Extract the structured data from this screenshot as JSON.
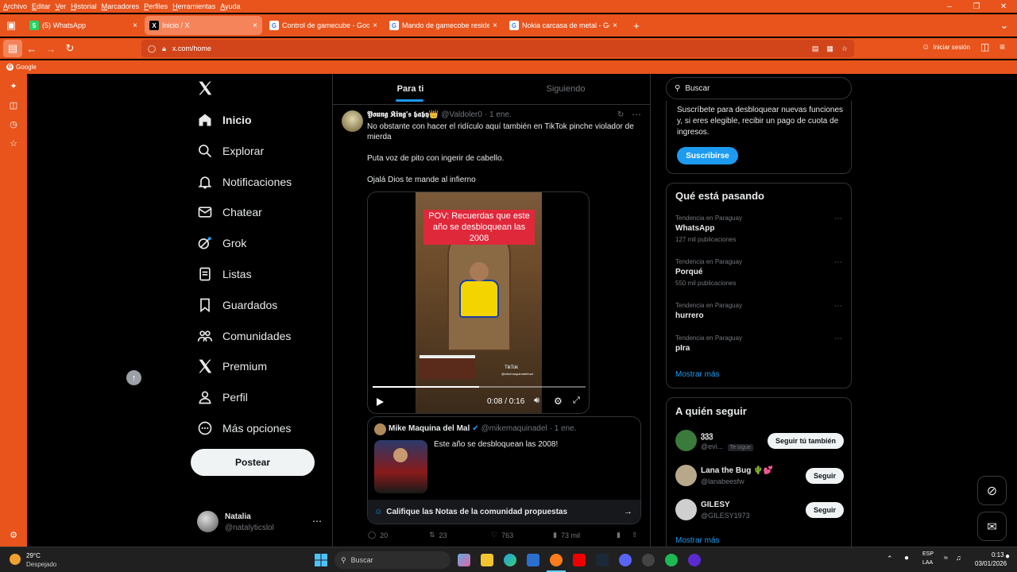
{
  "browser": {
    "menu": [
      "Archivo",
      "Editar",
      "Ver",
      "Historial",
      "Marcadores",
      "Perfiles",
      "Herramientas",
      "Ayuda"
    ],
    "tabs": [
      {
        "title": "(5) WhatsApp",
        "favicon": "whatsapp-icon",
        "color": "#25d366",
        "glyph": "5"
      },
      {
        "title": "Inicio / X",
        "favicon": "x-logo-icon",
        "color": "#000000",
        "glyph": "X"
      },
      {
        "title": "Control de gamecube - Google",
        "favicon": "google-icon",
        "color": "#ffffff",
        "glyph": "G"
      },
      {
        "title": "Mando de gamecobe resident e",
        "favicon": "google-icon",
        "color": "#ffffff",
        "glyph": "G"
      },
      {
        "title": "Nokia carcasa de metal - Googl",
        "favicon": "google-icon",
        "color": "#ffffff",
        "glyph": "G"
      }
    ],
    "url": "x.com/home",
    "signin": "Iniciar sesión",
    "bookmark": "Google",
    "accent": "#e8541c"
  },
  "nav": {
    "items": [
      {
        "label": "Inicio",
        "icon": "home-icon",
        "bold": true
      },
      {
        "label": "Explorar",
        "icon": "search-icon"
      },
      {
        "label": "Notificaciones",
        "icon": "bell-icon"
      },
      {
        "label": "Chatear",
        "icon": "mail-icon"
      },
      {
        "label": "Grok",
        "icon": "grok-icon"
      },
      {
        "label": "Listas",
        "icon": "list-icon"
      },
      {
        "label": "Guardados",
        "icon": "bookmark-icon"
      },
      {
        "label": "Comunidades",
        "icon": "communities-icon"
      },
      {
        "label": "Premium",
        "icon": "x-premium-icon"
      },
      {
        "label": "Perfil",
        "icon": "person-icon"
      },
      {
        "label": "Más opciones",
        "icon": "more-circle-icon"
      }
    ],
    "post_label": "Postear",
    "account": {
      "name": "Natalia",
      "handle": "@natalyticslol"
    }
  },
  "feed": {
    "tabs": [
      "Para ti",
      "Siguiendo"
    ],
    "post": {
      "author": "𝖄𝖔𝖚𝖓𝖌 𝕶𝖎𝖓𝖌'𝖘 𝖇𝖆𝖇𝖞👑",
      "handle": "@Valdoler0",
      "date": "· 1 ene.",
      "lines": [
        "No obstante con hacer el ridículo aquí también en TikTok pinche violador de mierda",
        "Puta voz de pito con ingerir de cabello.",
        "Ojalá Dios te mande al infierno"
      ],
      "video": {
        "caption": "POV: Recuerdas que este año se desbloquean las 2008",
        "time": "0:08 / 0:16",
        "tiktok": "TikTok",
        "tiktok_handle": "@mikemaquinadelmal",
        "progress": 0.5
      },
      "quote": {
        "author": "Mike Maquina del Mal",
        "handle": "@mikemaquinadel",
        "date": "· 1 ene.",
        "text": "Este año se desbloquean las 2008!"
      },
      "notes": "Califique las Notas de la comunidad propuestas",
      "stats": {
        "replies": "20",
        "reposts": "23",
        "likes": "763",
        "views": "73 mil"
      }
    }
  },
  "right": {
    "search_placeholder": "Buscar",
    "premium_text": "Suscríbete para desbloquear nuevas funciones y, si eres elegible, recibir un pago de cuota de ingresos.",
    "subscribe": "Suscribirse",
    "trends_title": "Qué está pasando",
    "trends": [
      {
        "context": "Tendencia en Paraguay",
        "name": "WhatsApp",
        "posts": "127 mil publicaciones"
      },
      {
        "context": "Tendencia en Paraguay",
        "name": "Porqué",
        "posts": "550 mil publicaciones"
      },
      {
        "context": "Tendencia en Paraguay",
        "name": "hurrero",
        "posts": ""
      },
      {
        "context": "Tendencia en Paraguay",
        "name": "pIra",
        "posts": ""
      }
    ],
    "show_more": "Mostrar más",
    "follow_title": "A quién seguir",
    "follows": [
      {
        "name": "ვვვ",
        "handle": "@evi...",
        "badge": "Te sigue",
        "button": "Seguir tú también",
        "color": "#3a7a3a"
      },
      {
        "name": "Lana the Bug 🌵💕",
        "handle": "@lanabeesfw",
        "badge": "",
        "button": "Seguir",
        "color": "#b8a88a"
      },
      {
        "name": "GILESY",
        "handle": "@GILESY1973",
        "badge": "",
        "button": "Seguir",
        "color": "#cfcfcf"
      }
    ],
    "show_more2": "Mostrar más"
  },
  "taskbar": {
    "weather_temp": "29°C",
    "weather_desc": "Despejado",
    "search": "Buscar",
    "lang1": "ESP",
    "lang2": "LAA",
    "time": "0:13",
    "date": "03/01/2026"
  }
}
